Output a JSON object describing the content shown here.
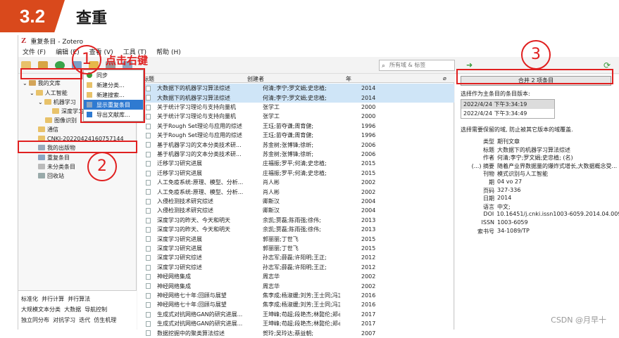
{
  "banner": {
    "number": "3.2",
    "title": "查重"
  },
  "window": {
    "title": "重复条目 - Zotero"
  },
  "menu": [
    "文件 (F)",
    "编辑 (E)",
    "查看 (V)",
    "工具 (T)",
    "帮助 (H)"
  ],
  "search": {
    "placeholder": "所有域 & 标签"
  },
  "tree": {
    "my_library": "我的文库",
    "items": [
      "人工智能",
      "机器学习",
      "深度学习",
      "图像识别",
      "通信",
      "CNKI-20220424160757144",
      "我的出版物",
      "重复条目",
      "未分类条目",
      "回收站"
    ]
  },
  "context_menu": [
    "同步",
    "新建分类...",
    "新建搜索...",
    "显示重复条目",
    "导出文献库..."
  ],
  "columns": {
    "title": "标题",
    "creator": "创建者",
    "year": "年"
  },
  "rows": [
    {
      "title": "大数据下的机器学习算法综述",
      "creator": "何清;李宁;罗文娟;史忠植;",
      "year": "2014",
      "sel": true
    },
    {
      "title": "大数据下的机器学习算法综述",
      "creator": "何清;李宁;罗文娟;史忠植;",
      "year": "2014",
      "sel": true
    },
    {
      "title": "关于统计学习理论与支持向量机",
      "creator": "张学工",
      "year": "2000",
      "sel": false
    },
    {
      "title": "关于统计学习理论与支持向量机",
      "creator": "张学工",
      "year": "2000",
      "sel": false
    },
    {
      "title": "关于Rough Set理论与应用的综述",
      "creator": "王珏;苗夺谦;周育健;",
      "year": "1996",
      "sel": false
    },
    {
      "title": "关于Rough Set理论与应用的综述",
      "creator": "王珏;苗夺谦;周育健;",
      "year": "1996",
      "sel": false
    },
    {
      "title": "基于机器学习的文本分类技术研...",
      "creator": "苏金树;张博锋;徐昕;",
      "year": "2006",
      "sel": false
    },
    {
      "title": "基于机器学习的文本分类技术研...",
      "creator": "苏金树;张博锋;徐昕;",
      "year": "2006",
      "sel": false
    },
    {
      "title": "迁移学习研究进展",
      "creator": "庄福振;罗平;何清;史忠植;",
      "year": "2015",
      "sel": false
    },
    {
      "title": "迁移学习研究进展",
      "creator": "庄福振;罗平;何清;史忠植;",
      "year": "2015",
      "sel": false
    },
    {
      "title": "人工免疫系统:原理、模型、分析...",
      "creator": "肖人彬",
      "year": "2002",
      "sel": false
    },
    {
      "title": "人工免疫系统:原理、模型、分析...",
      "creator": "肖人彬",
      "year": "2002",
      "sel": false
    },
    {
      "title": "入侵检测技术研究综述",
      "creator": "卿斯汉",
      "year": "2004",
      "sel": false
    },
    {
      "title": "入侵检测技术研究综述",
      "creator": "卿斯汉",
      "year": "2004",
      "sel": false
    },
    {
      "title": "深度学习的昨天、今天和明天",
      "creator": "余凯;贾磊;陈雨强;徐伟;",
      "year": "2013",
      "sel": false
    },
    {
      "title": "深度学习的昨天、今天和明天",
      "creator": "余凯;贾磊;陈雨强;徐伟;",
      "year": "2013",
      "sel": false
    },
    {
      "title": "深度学习研究进展",
      "creator": "郭丽丽;丁世飞",
      "year": "2015",
      "sel": false
    },
    {
      "title": "深度学习研究进展",
      "creator": "郭丽丽;丁世飞",
      "year": "2015",
      "sel": false
    },
    {
      "title": "深度学习研究综述",
      "creator": "孙志军;薛磊;许阳明;王正;",
      "year": "2012",
      "sel": false
    },
    {
      "title": "深度学习研究综述",
      "creator": "孙志军;薛磊;许阳明;王正;",
      "year": "2012",
      "sel": false
    },
    {
      "title": "神经网络集成",
      "creator": "周志华",
      "year": "2002",
      "sel": false
    },
    {
      "title": "神经网络集成",
      "creator": "周志华",
      "year": "2002",
      "sel": false
    },
    {
      "title": "神经网络七十年:回顾与展望",
      "creator": "焦李成;杨淑媛;刘芳;王士同;冯志敏;",
      "year": "2016",
      "sel": false
    },
    {
      "title": "神经网络七十年:回顾与展望",
      "creator": "焦李成;杨淑媛;刘芳;王士同;冯志敏;",
      "year": "2016",
      "sel": false
    },
    {
      "title": "生成式对抗网络GAN的研究进展...",
      "creator": "王坤峰;苟超;段艳杰;林懿伦;郑心湖;...",
      "year": "2017",
      "sel": false
    },
    {
      "title": "生成式对抗网络GAN的研究进展...",
      "creator": "王坤峰;苟超;段艳杰;林懿伦;郑心湖;...",
      "year": "2017",
      "sel": false
    },
    {
      "title": "数据挖掘中的聚类算法综述",
      "creator": "贺玲;吴玲达;蔡益朝;",
      "year": "2007",
      "sel": false
    }
  ],
  "right": {
    "merge_button": "合并 2 项条目",
    "pick_label": "选择作为主条目的条目版本:",
    "versions": [
      "2022/4/24 下午3:34:19",
      "2022/4/24 下午3:34:49"
    ],
    "choose_label": "选择需要保留的域, 防止被其它版本的域覆盖.",
    "fields": [
      {
        "k": "类型",
        "v": "期刊文章"
      },
      {
        "k": "标题",
        "v": "大数据下的机器学习算法综述"
      },
      {
        "k": "作者",
        "v": "何清;李宁;罗文娟;史忠植; (名)"
      },
      {
        "k": "(...) 摘要",
        "v": "随着产业界数据量的爆炸式增长,大数据概念受..."
      },
      {
        "k": "刊物",
        "v": "模式识别与人工智能"
      },
      {
        "k": "期",
        "v": "04 vo 27"
      },
      {
        "k": "页码",
        "v": "327-336"
      },
      {
        "k": "日期",
        "v": "2014"
      },
      {
        "k": "语言",
        "v": "中文;"
      },
      {
        "k": "DOI",
        "v": "10.16451/j.cnki.issn1003-6059.2014.04.009"
      },
      {
        "k": "ISSN",
        "v": "1003-6059"
      },
      {
        "k": "索书号",
        "v": "34-1089/TP"
      }
    ]
  },
  "tags": [
    "标准化",
    "并行计算",
    "并行算法",
    "大规模文本分类",
    "大数据",
    "导航控制",
    "独立同分布",
    "对抗学习",
    "迭代",
    "仿生机理"
  ],
  "annotations": {
    "step1": "1",
    "step1_text": "点击右键",
    "step2": "2",
    "step3": "3"
  },
  "watermark": "CSDN @月早十"
}
